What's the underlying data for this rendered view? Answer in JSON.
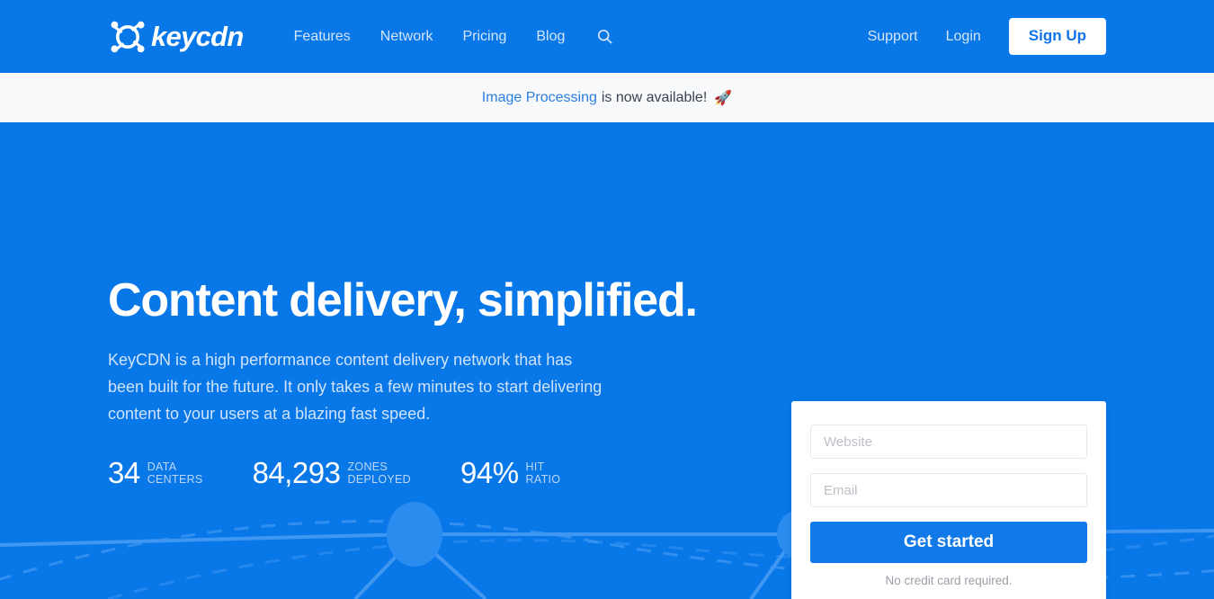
{
  "brand": {
    "logo_text": "keycdn",
    "logo_icon": "keycdn-circle-key-icon",
    "primary_blue": "#0877e8",
    "accent_button_blue": "#1279e8",
    "header_text_color": "#d4e5f9"
  },
  "header": {
    "nav_items": [
      {
        "label": "Features",
        "name": "nav-link-features"
      },
      {
        "label": "Network",
        "name": "nav-link-network"
      },
      {
        "label": "Pricing",
        "name": "nav-link-pricing"
      },
      {
        "label": "Blog",
        "name": "nav-link-blog"
      }
    ],
    "search_icon": "search-icon",
    "support_label": "Support",
    "login_label": "Login",
    "signup_label": "Sign Up"
  },
  "banner": {
    "link_label": "Image Processing",
    "text": "is now available!",
    "emoji": "🚀",
    "background": "#f7f9fb"
  },
  "hero": {
    "title": "Content delivery, simplified.",
    "subtitle": "KeyCDN is a high performance content delivery network that has been built for the future. It only takes a few minutes to start delivering content to your users at a blazing fast speed.",
    "stats": [
      {
        "value": "34",
        "label_line1": "DATA",
        "label_line2": "CENTERS"
      },
      {
        "value": "84,293",
        "label_line1": "ZONES",
        "label_line2": "DEPLOYED"
      },
      {
        "value": "94%",
        "label_line1": "HIT",
        "label_line2": "RATIO"
      }
    ]
  },
  "signup_form": {
    "website_placeholder": "Website",
    "website_value": "",
    "email_placeholder": "Email",
    "email_value": "",
    "submit_label": "Get started",
    "footnote": "No credit card required."
  },
  "decor": {
    "name": "network-nodes-graphic",
    "node_color": "#2b8cf0",
    "line_color": "#3e96f2"
  }
}
